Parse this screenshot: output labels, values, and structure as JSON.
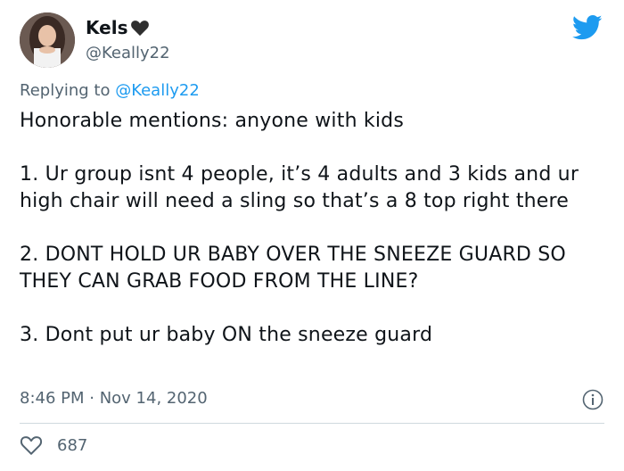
{
  "author": {
    "display_name": "Kels",
    "handle": "@Keally22",
    "avatar_icon": "profile-photo"
  },
  "reply": {
    "prefix": "Replying to ",
    "mention": "@Keally22"
  },
  "tweet": {
    "paragraphs": [
      "Honorable mentions: anyone with kids",
      "1. Ur group isnt 4 people, it’s 4 adults and 3 kids and ur high chair will need a sling so that’s a 8 top right there",
      "2. DONT HOLD UR BABY OVER THE SNEEZE GUARD SO THEY CAN GRAB FOOD FROM THE LINE?",
      "3. Dont put ur baby ON the sneeze guard"
    ]
  },
  "meta": {
    "time": "8:46 PM",
    "separator": " · ",
    "date": "Nov 14, 2020"
  },
  "engagement": {
    "likes": "687"
  },
  "colors": {
    "brand_blue": "#1d9bf0",
    "secondary_text": "#536471"
  },
  "icons": [
    "heart-icon",
    "twitter-bird-icon",
    "info-icon",
    "like-heart-icon"
  ]
}
